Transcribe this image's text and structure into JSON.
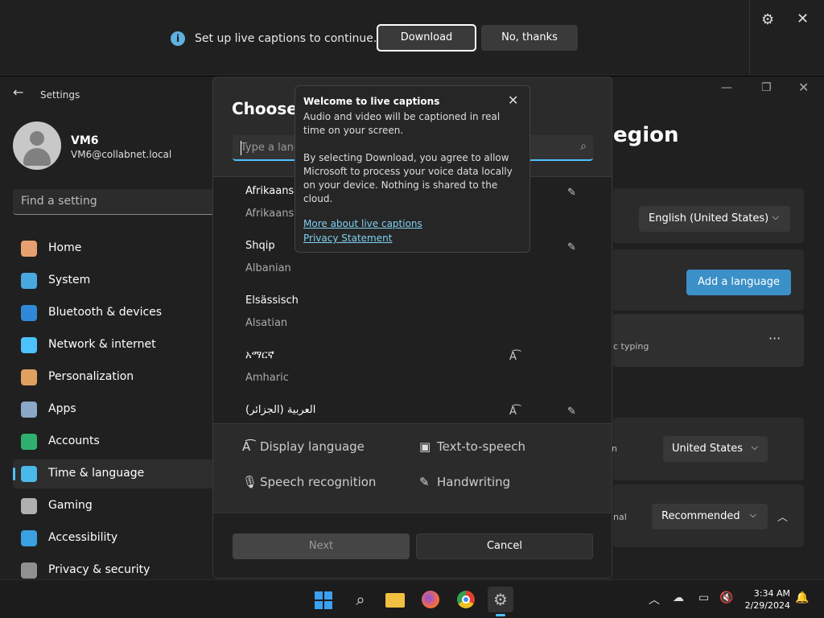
{
  "banner": {
    "message": "Set up live captions to continue.",
    "download_label": "Download",
    "no_thanks_label": "No, thanks"
  },
  "settings": {
    "title": "Settings",
    "user": {
      "name": "VM6",
      "email": "VM6@collabnet.local"
    },
    "search_placeholder": "Find a setting",
    "nav": [
      {
        "label": "Home",
        "icon": "home-icon",
        "color": "#e8a070"
      },
      {
        "label": "System",
        "icon": "system-icon",
        "color": "#4aa8e0"
      },
      {
        "label": "Bluetooth & devices",
        "icon": "bluetooth-icon",
        "color": "#2f88d8"
      },
      {
        "label": "Network & internet",
        "icon": "wifi-icon",
        "color": "#4cc2ff"
      },
      {
        "label": "Personalization",
        "icon": "brush-icon",
        "color": "#e0a060"
      },
      {
        "label": "Apps",
        "icon": "apps-icon",
        "color": "#8aa8c8"
      },
      {
        "label": "Accounts",
        "icon": "accounts-icon",
        "color": "#30b070"
      },
      {
        "label": "Time & language",
        "icon": "globe-icon",
        "color": "#4ab8e8"
      },
      {
        "label": "Gaming",
        "icon": "gamepad-icon",
        "color": "#b0b0b0"
      },
      {
        "label": "Accessibility",
        "icon": "accessibility-icon",
        "color": "#3aa0e0"
      },
      {
        "label": "Privacy & security",
        "icon": "shield-icon",
        "color": "#909090"
      }
    ],
    "right": {
      "heading_partial": "egion",
      "display_language_value": "English (United States)",
      "add_language_label": "Add a language",
      "typing_partial": "c typing",
      "country_value": "United States",
      "format_value": "Recommended",
      "nal_partial": "nal",
      "country_label_partial": "n"
    }
  },
  "dialog": {
    "title_partial": "Choose a",
    "search_placeholder": "Type a lang",
    "languages": [
      {
        "native": "Afrikaans",
        "english": "Afrikaans",
        "f1": "",
        "f2": "✎"
      },
      {
        "native": "Shqip",
        "english": "Albanian",
        "f1": "",
        "f2": "✎"
      },
      {
        "native": "Elsässisch",
        "english": "Alsatian",
        "f1": "",
        "f2": ""
      },
      {
        "native": "አማርኛ",
        "english": "Amharic",
        "f1": "A͡",
        "f2": ""
      },
      {
        "native": "العربية (الجزائر)",
        "english": "",
        "f1": "A͡",
        "f2": "✎"
      }
    ],
    "legend": {
      "display_language": "Display language",
      "text_to_speech": "Text-to-speech",
      "speech_recognition": "Speech recognition",
      "handwriting": "Handwriting"
    },
    "next_label": "Next",
    "cancel_label": "Cancel"
  },
  "popup": {
    "title": "Welcome to live captions",
    "line1": "Audio and video will be captioned in real time on your screen.",
    "line2": "By selecting Download, you agree to allow Microsoft to process your voice data locally on your device. Nothing is shared to the cloud.",
    "link1": "More about live captions",
    "link2": "Privacy Statement"
  },
  "taskbar": {
    "time": "3:34 AM",
    "date": "2/29/2024"
  }
}
